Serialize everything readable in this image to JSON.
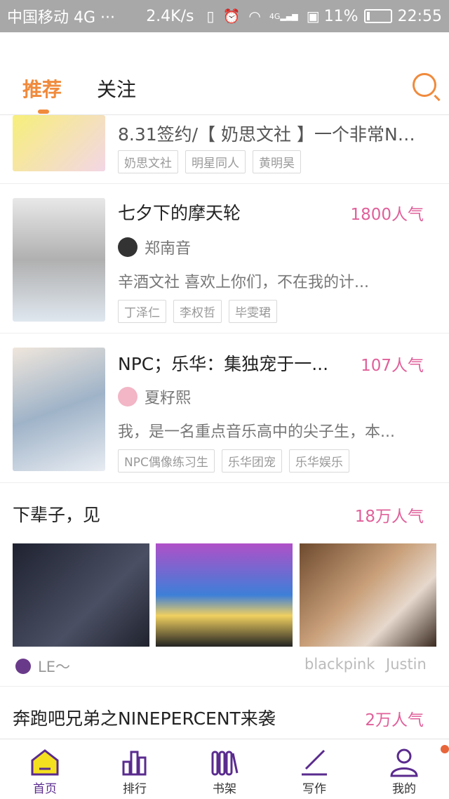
{
  "status_bar": {
    "carrier": "中国移动 4G ···",
    "speed": "2.4K/s",
    "battery": "11%",
    "time": "22:55",
    "network": "4G"
  },
  "header": {
    "tabs": [
      {
        "label": "推荐",
        "active": true
      },
      {
        "label": "关注",
        "active": false
      }
    ],
    "search_icon": "search-icon"
  },
  "feed": [
    {
      "title": "8.31签约/【 奶思文社 】一个非常NB的...",
      "tags": [
        "奶思文社",
        "明星同人",
        "黄明昊"
      ],
      "cover_color": "#f2e86a"
    },
    {
      "title": "七夕下的摩天轮",
      "popularity": "1800人气",
      "author": "郑南音",
      "desc": "辛酒文社 喜欢上你们，不在我的计...",
      "tags": [
        "丁泽仁",
        "李权哲",
        "毕雯珺"
      ],
      "cover_color": "#c9c9c9"
    },
    {
      "title": "NPC；乐华：集独宠于一...",
      "popularity": "107人气",
      "author": "夏籽熙",
      "desc": "我，是一名重点音乐高中的尖子生，本...",
      "tags": [
        "NPC偶像练习生",
        "乐华团宠",
        "乐华娱乐"
      ],
      "cover_color": "#b8c6d6"
    },
    {
      "title": "下辈子，见",
      "popularity": "18万人气",
      "author": "LE～",
      "extra_tags": [
        "blackpink",
        "Justin"
      ]
    },
    {
      "title": "奔跑吧兄弟之NINEPERCENT来袭",
      "popularity": "2万人气"
    }
  ],
  "bottom_nav": [
    {
      "label": "首页",
      "icon": "home-icon",
      "active": true
    },
    {
      "label": "排行",
      "icon": "ranking-icon",
      "active": false
    },
    {
      "label": "书架",
      "icon": "bookshelf-icon",
      "active": false
    },
    {
      "label": "写作",
      "icon": "write-icon",
      "active": false
    },
    {
      "label": "我的",
      "icon": "profile-icon",
      "active": false,
      "badge": true
    }
  ],
  "colors": {
    "accent": "#f08a3c",
    "popularity": "#e0609a",
    "nav_active": "#5a2b8e"
  }
}
